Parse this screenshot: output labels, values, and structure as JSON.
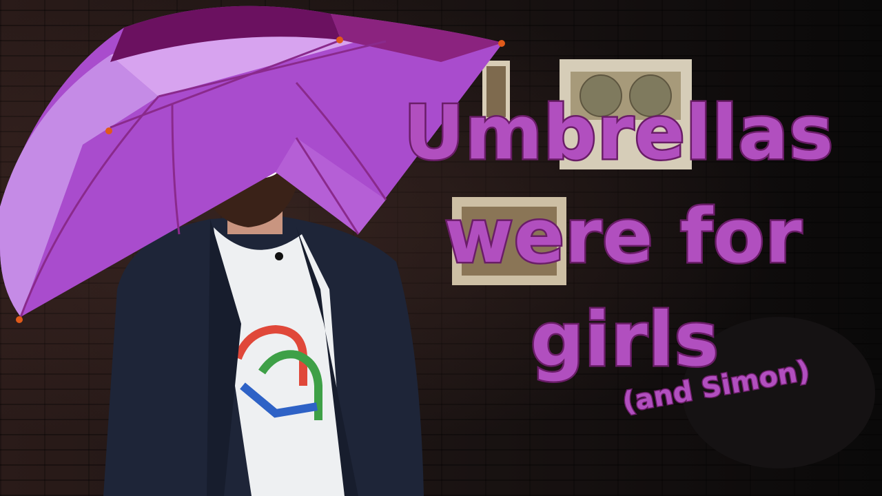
{
  "caption": {
    "line1": "Umbrellas",
    "line2": "were for",
    "line3": "girls",
    "aside": "(and Simon)"
  },
  "scene": {
    "subject": "bald bearded man wearing glasses and a dark blazer over a white t-shirt",
    "prop": "purple umbrella",
    "setting": "dark brick wall with framed map pictures"
  },
  "colors": {
    "text_fill": "#b14fbf",
    "text_outline": "#6a1d68",
    "umbrella_light": "#c58be6",
    "umbrella_mid": "#a94ccd",
    "umbrella_dark": "#6b1160"
  }
}
